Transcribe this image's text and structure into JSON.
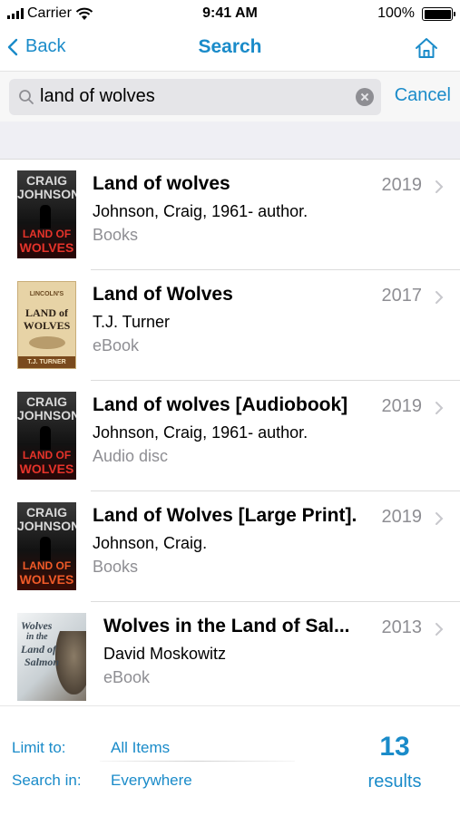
{
  "status": {
    "carrier": "Carrier",
    "time": "9:41 AM",
    "battery": "100%"
  },
  "nav": {
    "back": "Back",
    "title": "Search"
  },
  "search": {
    "query": "land of wolves",
    "cancel": "Cancel"
  },
  "results": [
    {
      "title": "Land of wolves",
      "author": "Johnson, Craig, 1961- author.",
      "format": "Books",
      "year": "2019"
    },
    {
      "title": "Land of Wolves",
      "author": "T.J. Turner",
      "format": "eBook",
      "year": "2017"
    },
    {
      "title": "Land of wolves [Audiobook]",
      "author": "Johnson, Craig, 1961- author.",
      "format": "Audio disc",
      "year": "2019"
    },
    {
      "title": "Land of Wolves [Large Print].",
      "author": "Johnson, Craig.",
      "format": "Books",
      "year": "2019"
    },
    {
      "title": "Wolves in the Land of Sal...",
      "author": "David Moskowitz",
      "format": "eBook",
      "year": "2013"
    }
  ],
  "covers": {
    "johnson_top": "CRAIG",
    "johnson_mid": "JOHNSON",
    "johnson_bottom_1": "LAND OF",
    "johnson_bottom_2": "WOLVES",
    "turner_top": "LINCOLN'S",
    "turner_mid_1": "LAND of",
    "turner_mid_2": "WOLVES",
    "turner_bottom": "T.J. TURNER",
    "moskowitz_1": "Wolves",
    "moskowitz_2": "in the",
    "moskowitz_3": "Land of",
    "moskowitz_4": "Salmon"
  },
  "footer": {
    "limit_label": "Limit to:",
    "limit_value": "All Items",
    "search_label": "Search in:",
    "search_value": "Everywhere",
    "count": "13",
    "count_label": "results"
  },
  "colors": {
    "accent": "#1a8bc9",
    "secondary_text": "#8e8e93"
  }
}
